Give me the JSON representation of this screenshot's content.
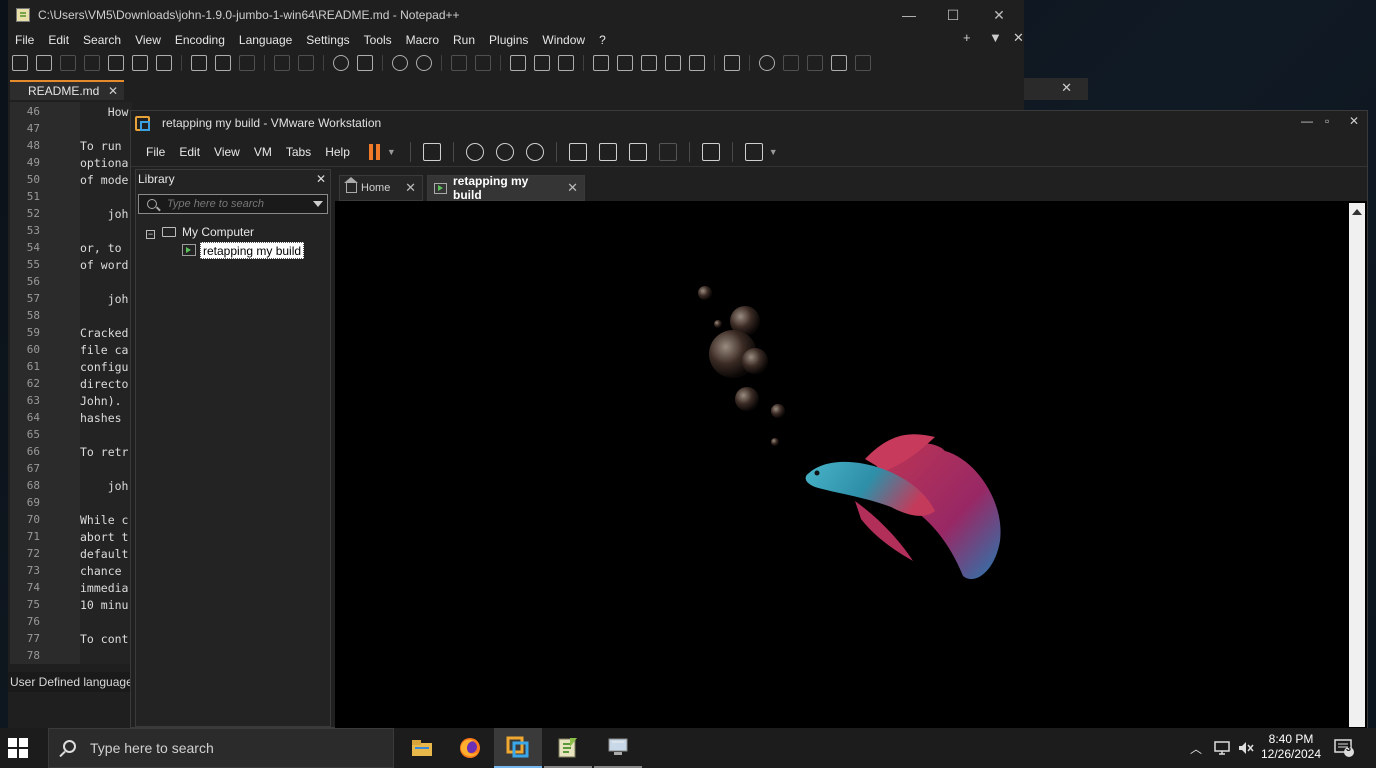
{
  "notepad": {
    "title": "C:\\Users\\VM5\\Downloads\\john-1.9.0-jumbo-1-win64\\README.md - Notepad++",
    "menu": [
      "File",
      "Edit",
      "Search",
      "View",
      "Encoding",
      "Language",
      "Settings",
      "Tools",
      "Macro",
      "Run",
      "Plugins",
      "Window",
      "?"
    ],
    "tab": "README.md",
    "lines": [
      {
        "n": "46",
        "t": "    How to use"
      },
      {
        "n": "47",
        "t": ""
      },
      {
        "n": "48",
        "t": "To run"
      },
      {
        "n": "49",
        "t": "optiona"
      },
      {
        "n": "50",
        "t": "of mode"
      },
      {
        "n": "51",
        "t": ""
      },
      {
        "n": "52",
        "t": "    joh"
      },
      {
        "n": "53",
        "t": ""
      },
      {
        "n": "54",
        "t": "or, to"
      },
      {
        "n": "55",
        "t": "of word"
      },
      {
        "n": "56",
        "t": ""
      },
      {
        "n": "57",
        "t": "    joh"
      },
      {
        "n": "58",
        "t": ""
      },
      {
        "n": "59",
        "t": "Cracked"
      },
      {
        "n": "60",
        "t": "file ca"
      },
      {
        "n": "61",
        "t": "configu"
      },
      {
        "n": "62",
        "t": "directo"
      },
      {
        "n": "63",
        "t": "John)."
      },
      {
        "n": "64",
        "t": "hashes"
      },
      {
        "n": "65",
        "t": ""
      },
      {
        "n": "66",
        "t": "To retr"
      },
      {
        "n": "67",
        "t": ""
      },
      {
        "n": "68",
        "t": "    joh"
      },
      {
        "n": "69",
        "t": ""
      },
      {
        "n": "70",
        "t": "While c"
      },
      {
        "n": "71",
        "t": "abort t"
      },
      {
        "n": "72",
        "t": "default"
      },
      {
        "n": "73",
        "t": "chance"
      },
      {
        "n": "74",
        "t": "immedia"
      },
      {
        "n": "75",
        "t": "10 minu"
      },
      {
        "n": "76",
        "t": ""
      },
      {
        "n": "77",
        "t": "To cont"
      },
      {
        "n": "78",
        "t": ""
      }
    ],
    "status": "User Defined language"
  },
  "vmware": {
    "title": "retapping my build - VMware Workstation",
    "menu": [
      "File",
      "Edit",
      "View",
      "VM",
      "Tabs",
      "Help"
    ],
    "library": {
      "header": "Library",
      "search_placeholder": "Type here to search",
      "root": "My Computer",
      "vm": "retapping my build"
    },
    "tabs": {
      "home": "Home",
      "vm": "retapping my build"
    }
  },
  "taskbar": {
    "search_placeholder": "Type here to search",
    "time": "8:40 PM",
    "date": "12/26/2024",
    "notifications": "3"
  },
  "colors": {
    "notepad_tab_accent": "#e58b2b",
    "vm_pause": "#f07a28",
    "taskbar_active": "#78b8f0"
  },
  "icons": {
    "notepad_toolbar": [
      "new-file-icon",
      "open-file-icon",
      "save-icon",
      "save-all-icon",
      "close-icon",
      "close-all-icon",
      "print-icon",
      "cut-icon",
      "copy-icon",
      "paste-icon",
      "undo-icon",
      "redo-icon",
      "find-icon",
      "replace-icon",
      "zoom-in-icon",
      "zoom-out-icon",
      "word-wrap-icon",
      "show-all-chars-icon",
      "indent-guide-icon",
      "xml-tag-icon",
      "document-map-icon",
      "function-list-icon",
      "folder-workspace-icon",
      "monitor-icon",
      "record-macro-icon",
      "stop-record-icon",
      "play-macro-icon",
      "run-macro-multiple-icon",
      "save-macro-icon"
    ],
    "taskbar_apps": [
      "file-explorer-icon",
      "firefox-icon",
      "vmware-icon",
      "notepad-plus-plus-icon",
      "remote-desktop-icon"
    ]
  }
}
